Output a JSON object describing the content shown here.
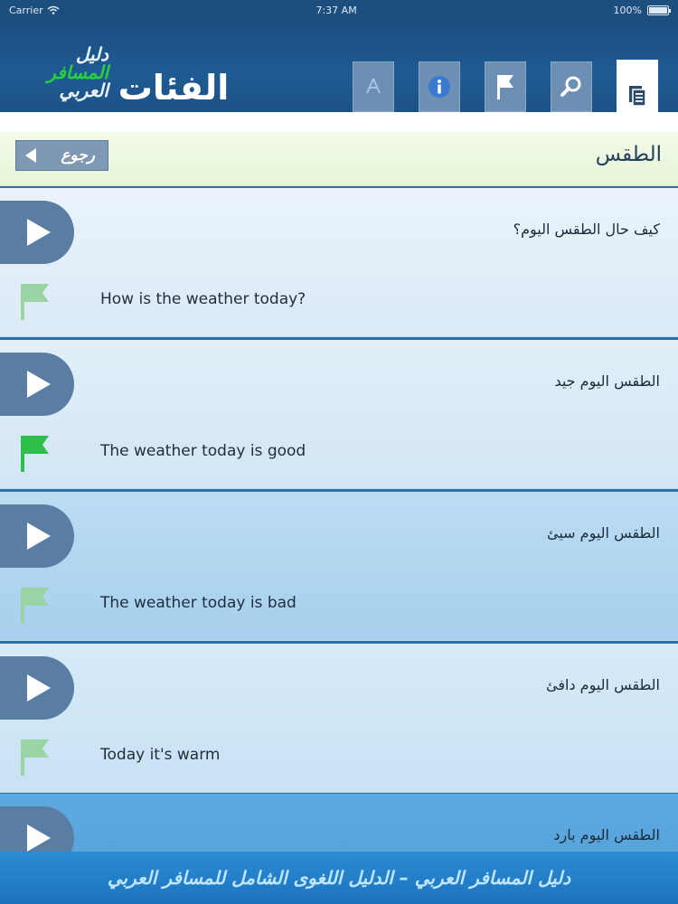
{
  "status": {
    "carrier": "Carrier",
    "time": "7:37 AM",
    "battery": "100%"
  },
  "header": {
    "logo_line1": "دليل",
    "logo_line2": "المسافر",
    "logo_line3": "العربي",
    "title": "الفئات",
    "buttons": [
      "app-store",
      "info",
      "flag",
      "search",
      "categories"
    ]
  },
  "subheader": {
    "back_label": "رجوع",
    "section_title": "الطقس"
  },
  "phrases": [
    {
      "arabic": "كيف حال الطقس اليوم؟",
      "english": "How is the weather today?",
      "flag_color": "#9ad3a4"
    },
    {
      "arabic": "الطقس اليوم جيد",
      "english": "The weather today is good",
      "flag_color": "#2fbe4a"
    },
    {
      "arabic": "الطقس اليوم سيئ",
      "english": "The weather today is bad",
      "flag_color": "#9ad3a4"
    },
    {
      "arabic": "الطقس اليوم دافئ",
      "english": "Today it's warm",
      "flag_color": "#9ad3a4"
    },
    {
      "arabic": "الطقس اليوم بارد",
      "english": "",
      "flag_color": "#9ad3a4"
    }
  ],
  "footer": {
    "text": "دليل المسافر العربي – الدليل اللغوى الشامل للمسافر العربي"
  },
  "colors": {
    "header_bg": "#1f5b93",
    "play_button": "#5a7ea3",
    "flag_active": "#2fbe4a",
    "flag_inactive": "#9ad3a4",
    "logo_green": "#27d13d"
  }
}
